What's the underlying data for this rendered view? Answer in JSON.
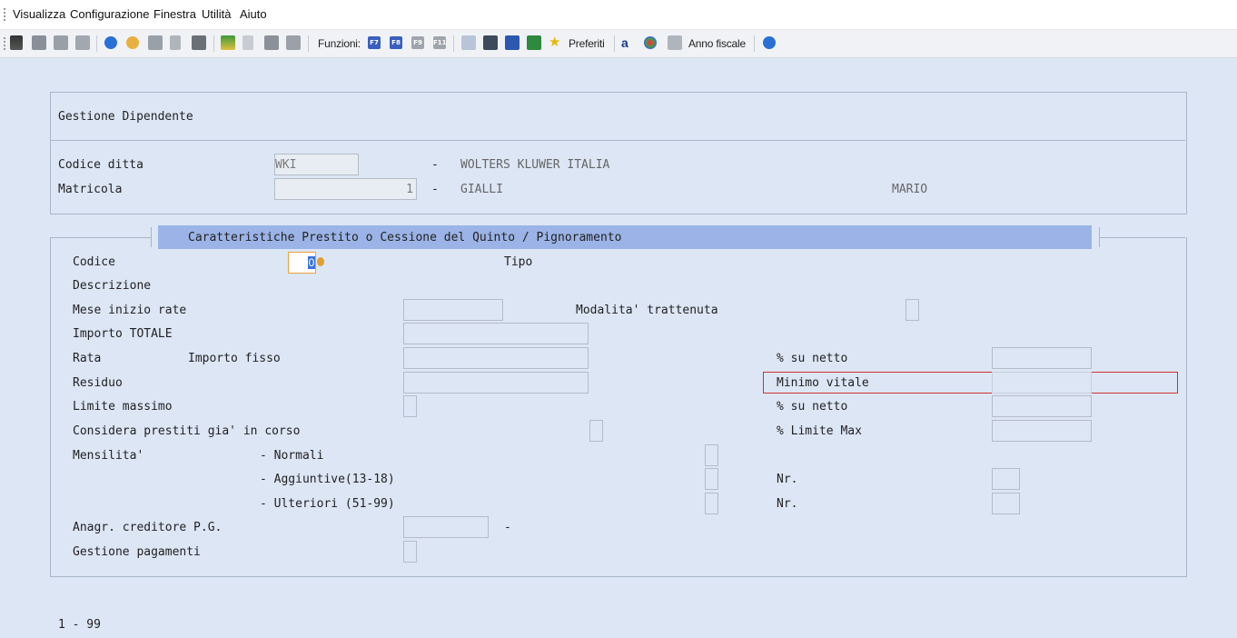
{
  "menu": [
    "Visualizza",
    "Configurazione",
    "Finestra",
    "Utilità",
    "Aiuto"
  ],
  "toolbar": {
    "funzioni_label": "Funzioni:",
    "fkeys": [
      "F7",
      "F8",
      "F9",
      "F11"
    ],
    "preferiti_label": "Preferiti",
    "anno_fiscale_label": "Anno fiscale"
  },
  "header_panel": {
    "title": "Gestione Dipendente",
    "codice_ditta_label": "Codice ditta",
    "codice_ditta_value": "WKI",
    "ditta_name": "WOLTERS KLUWER ITALIA",
    "matricola_label": "Matricola",
    "matricola_value": "1",
    "cognome": "GIALLI",
    "nome": "MARIO",
    "dash": "-"
  },
  "section": {
    "title": "Caratteristiche Prestito o Cessione del Quinto / Pignoramento",
    "codice_label": "Codice",
    "codice_value": "0",
    "tipo_label": "Tipo",
    "descrizione_label": "Descrizione",
    "mese_inizio_label": "Mese inizio rate",
    "modalita_label": "Modalita' trattenuta",
    "importo_totale_label": "Importo TOTALE",
    "rata_label": "Rata",
    "importo_fisso_label": "Importo fisso",
    "su_netto_label": "% su netto",
    "residuo_label": "Residuo",
    "minimo_vitale_label": "Minimo vitale",
    "limite_massimo_label": "Limite massimo",
    "su_netto2_label": "% su netto",
    "considera_label": "Considera prestiti gia' in corso",
    "limite_max_label": "% Limite Max",
    "mensilita_label": "Mensilita'",
    "normali_label": "- Normali",
    "aggiuntive_label": "- Aggiuntive(13-18)",
    "ulteriori_label": "- Ulteriori (51-99)",
    "nr_label": "Nr.",
    "nr2_label": "Nr.",
    "anagr_label": "Anagr. creditore P.G.",
    "anagr_dash": "-",
    "gestione_pagamenti_label": "Gestione pagamenti"
  },
  "footer": {
    "range": "1 - 99"
  }
}
